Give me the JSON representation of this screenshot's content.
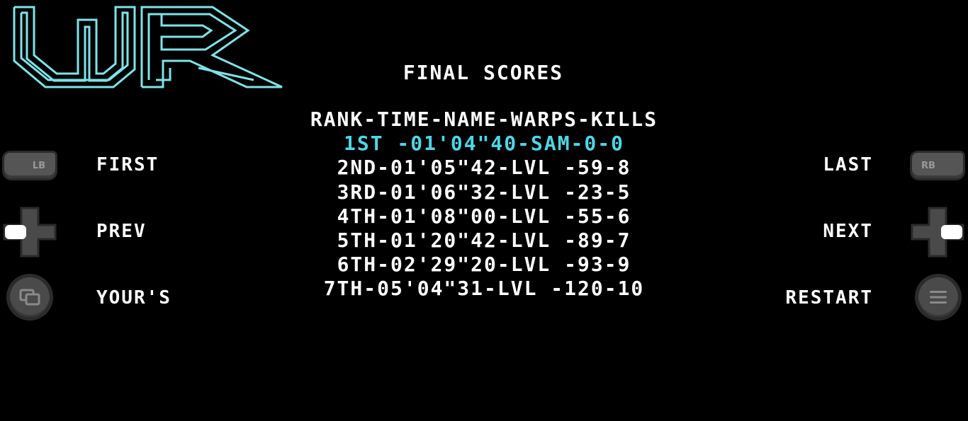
{
  "screen": {
    "title": "FINAL SCORES",
    "colors": {
      "background": "#000000",
      "text": "#ffffff",
      "highlight": "#4fd6e6",
      "logo": "#7fe3e8",
      "button": "#4a4a4a"
    }
  },
  "logo": {
    "text": "WR"
  },
  "scores": {
    "header": "RANK-TIME-NAME-WARPS-KILLS",
    "rows": [
      "1ST -01'04\"40-SAM-0-0",
      "2ND-01'05\"42-LVL -59-8",
      "3RD-01'06\"32-LVL -23-5",
      "4TH-01'08\"00-LVL -55-6",
      "5TH-01'20\"42-LVL -89-7",
      "6TH-02'29\"20-LVL -93-9",
      "7TH-05'04\"31-LVL -120-10"
    ]
  },
  "controls": {
    "first": {
      "label": "FIRST",
      "button": "LB",
      "icon": "lb-bumper-icon"
    },
    "prev": {
      "label": "PREV",
      "icon": "dpad-left-icon"
    },
    "yours": {
      "label": "YOUR'S",
      "icon": "view-button-icon"
    },
    "last": {
      "label": "LAST",
      "button": "RB",
      "icon": "rb-bumper-icon"
    },
    "next": {
      "label": "NEXT",
      "icon": "dpad-right-icon"
    },
    "restart": {
      "label": "RESTART",
      "icon": "menu-button-icon"
    }
  }
}
